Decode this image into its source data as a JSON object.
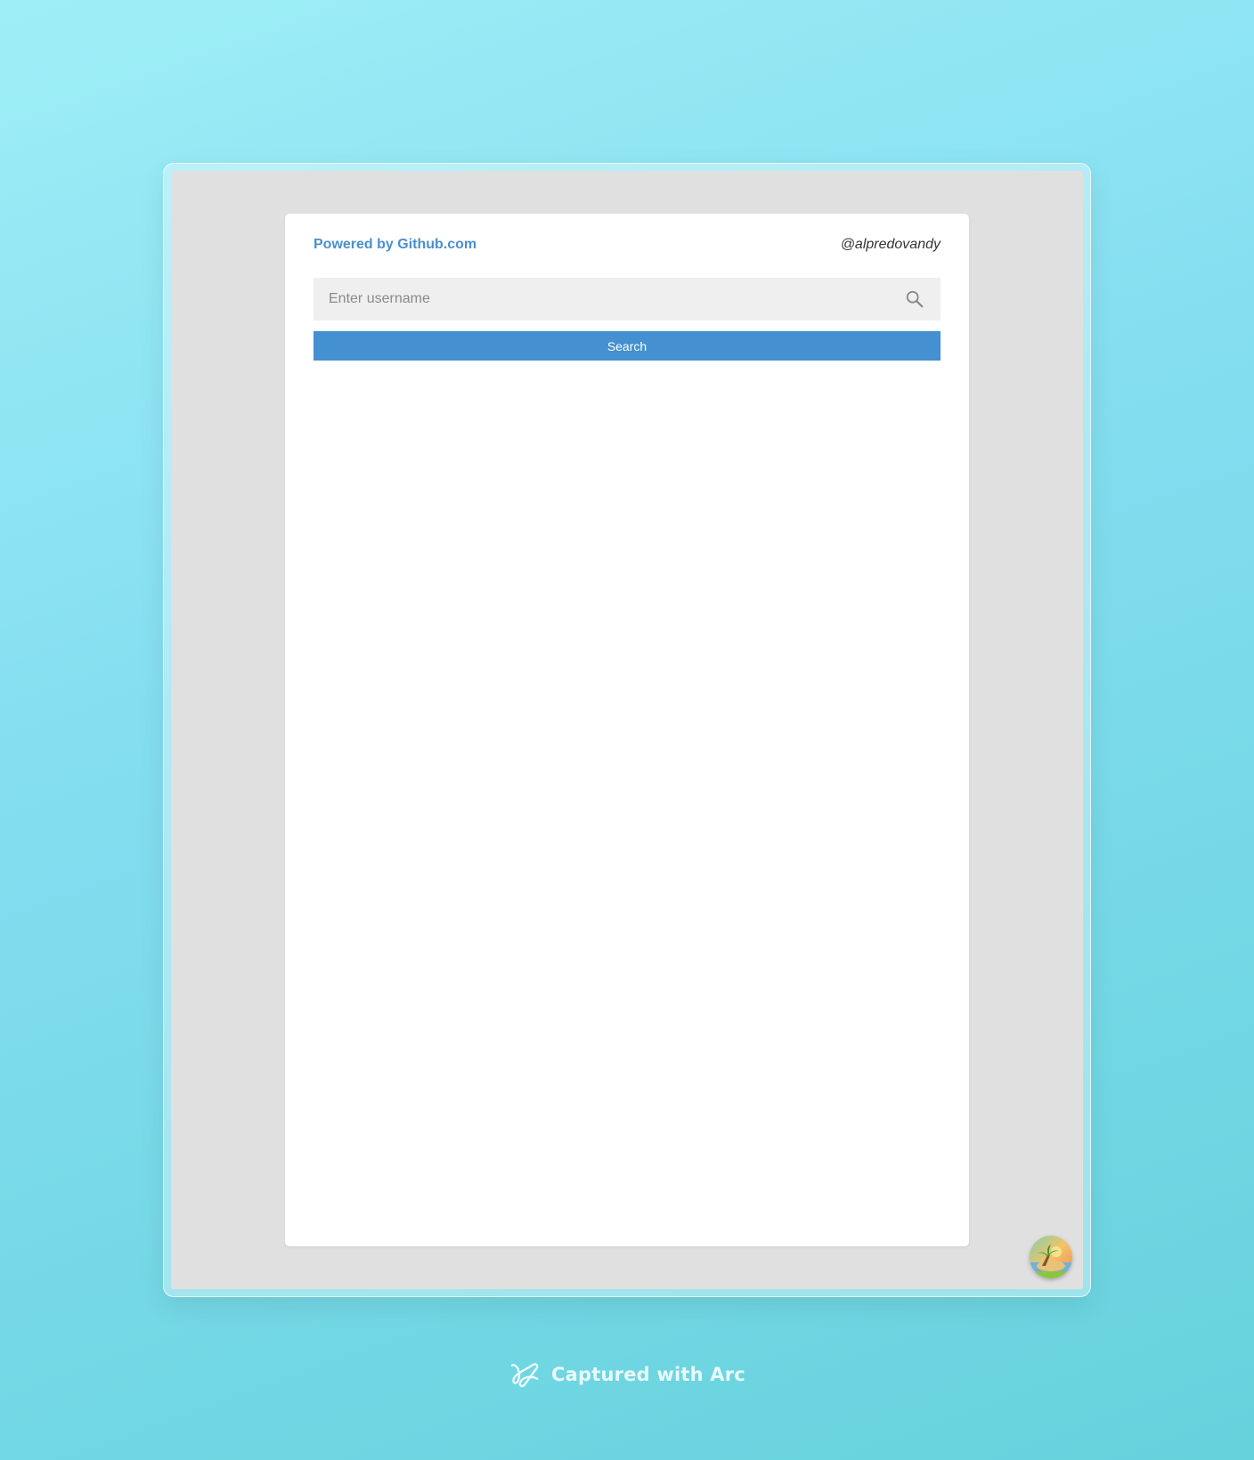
{
  "app": {
    "powered_by": "Powered by Github.com",
    "author": "@alpredovandy"
  },
  "search": {
    "placeholder": "Enter username",
    "value": "",
    "button_label": "Search",
    "icon": "search-icon"
  },
  "footer": {
    "caption": "Captured with Arc",
    "icon": "arc-logo-icon"
  },
  "colors": {
    "accent": "#4590d0",
    "link": "#4a8fce",
    "input_bg": "#efefef",
    "page_bg": "#e0e0e0"
  }
}
